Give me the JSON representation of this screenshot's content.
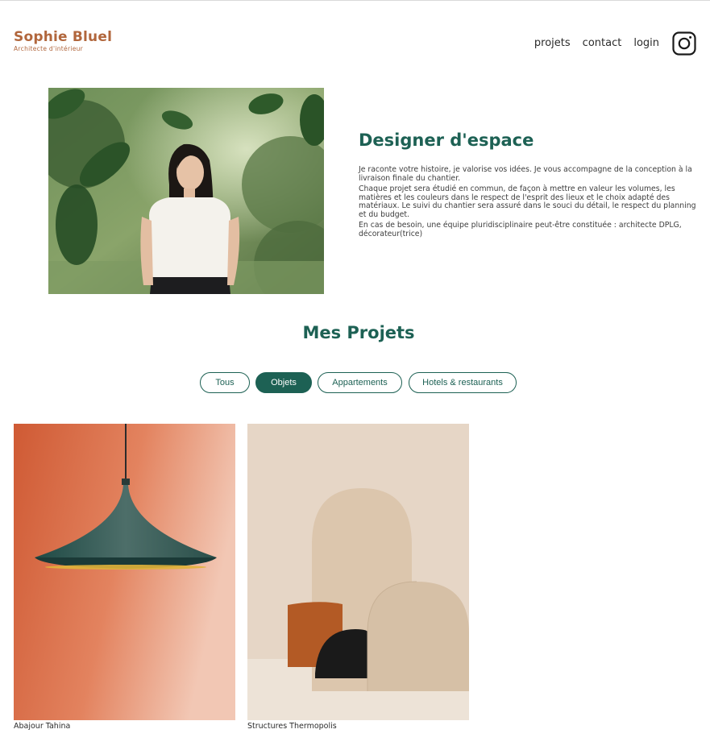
{
  "header": {
    "brand_name": "Sophie Bluel",
    "brand_subtitle": "Architecte d'intérieur",
    "nav": [
      "projets",
      "contact",
      "login"
    ],
    "social_icon": "instagram-icon"
  },
  "intro": {
    "title": "Designer d'espace",
    "paragraphs": [
      "Je raconte votre histoire, je valorise vos idées. Je vous accompagne de la conception à la livraison finale du chantier.",
      "Chaque projet sera étudié en commun, de façon à mettre en valeur les volumes, les matières et les couleurs dans le respect de l'esprit des lieux et le choix adapté des matériaux. Le suivi du chantier sera assuré dans le souci du détail, le respect du planning et du budget.",
      "En cas de besoin, une équipe pluridisciplinaire peut-être constituée : architecte DPLG, décorateur(trice)"
    ]
  },
  "projects": {
    "title": "Mes Projets",
    "filters": [
      "Tous",
      "Objets",
      "Appartements",
      "Hotels & restaurants"
    ],
    "active_filter": "Objets",
    "items": [
      {
        "caption": "Abajour Tahina"
      },
      {
        "caption": "Structures Thermopolis"
      }
    ]
  },
  "colors": {
    "brand": "#B1663C",
    "accent": "#1D6154",
    "text": "#3D3D3D"
  }
}
